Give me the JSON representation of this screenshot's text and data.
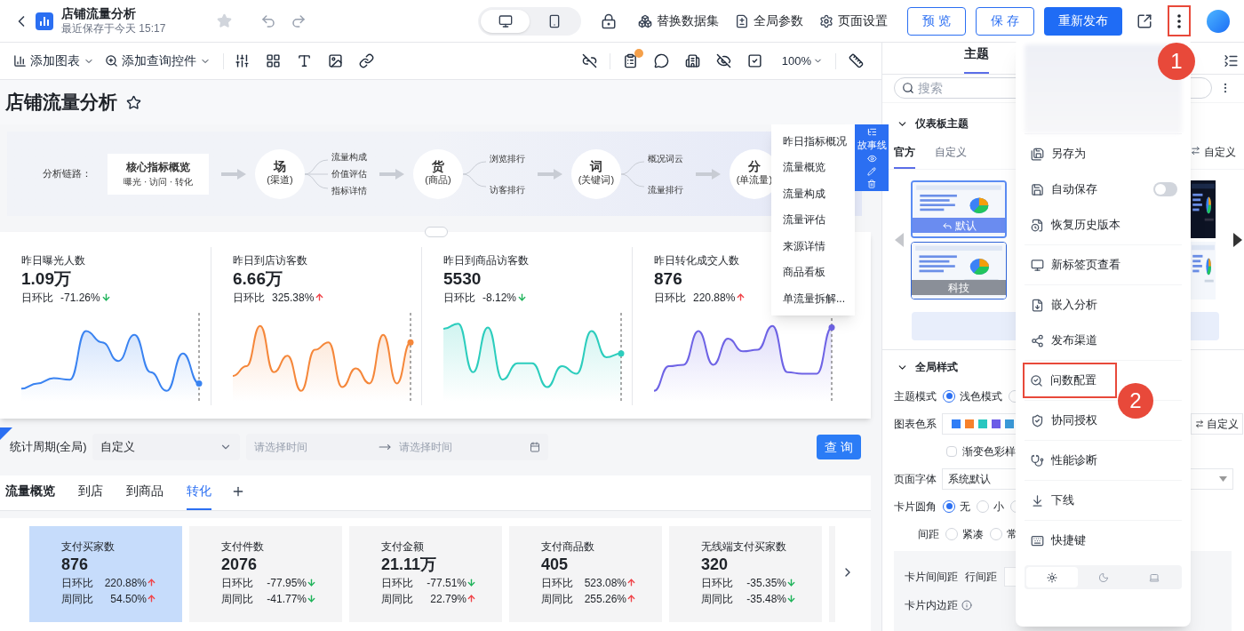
{
  "header": {
    "title": "店铺流量分析",
    "saved_text": "最近保存于今天 15:17",
    "starred": false,
    "device_modes": [
      {
        "kind": "desktop",
        "selected": true
      },
      {
        "kind": "mobile",
        "selected": false
      }
    ],
    "actions": [
      {
        "kind": "dataset",
        "label": "替换数据集"
      },
      {
        "kind": "params",
        "label": "全局参数"
      },
      {
        "kind": "settings",
        "label": "页面设置"
      }
    ],
    "buttons": [
      {
        "kind": "outline",
        "label": "预 览"
      },
      {
        "kind": "outline",
        "label": "保 存"
      },
      {
        "kind": "primary",
        "label": "重新发布"
      }
    ]
  },
  "toolbar": {
    "add_menus": [
      "添加图表",
      "添加查询控件"
    ],
    "zoom": "100%",
    "notes_alert": true
  },
  "page": {
    "title": "店铺流量分析",
    "starred": false
  },
  "chain": {
    "label": "分析链路：",
    "core": {
      "title": "核心指标概览",
      "subtitle": "曝光 · 访问 · 转化"
    },
    "nodes": [
      {
        "char": "场",
        "sub": "(渠道)",
        "branches": [
          "流量构成",
          "价值评估",
          "指标详情"
        ]
      },
      {
        "char": "货",
        "sub": "(商品)",
        "branches": [
          "浏览排行",
          "访客排行"
        ]
      },
      {
        "char": "词",
        "sub": "(关键词)",
        "branches": [
          "概况词云",
          "流量排行"
        ]
      },
      {
        "char": "分",
        "sub": "(单流量)"
      }
    ]
  },
  "story_nav": {
    "side_label": "故事线",
    "items": [
      "昨日指标概况",
      "流量概览",
      "流量构成",
      "流量评估",
      "来源详情",
      "商品看板",
      "单流量拆解..."
    ]
  },
  "kpis": [
    {
      "title": "昨日曝光人数",
      "value": "1.09万",
      "compare_label": "日环比",
      "change": "-71.26%",
      "rising": false,
      "color": "#3a83f1"
    },
    {
      "title": "昨日到店访客数",
      "value": "6.66万",
      "compare_label": "日环比",
      "change": "325.38%",
      "rising": true,
      "color": "#f5873a"
    },
    {
      "title": "昨日到商品访客数",
      "value": "5530",
      "compare_label": "日环比",
      "change": "-8.12%",
      "rising": false,
      "color": "#2ccdbd"
    },
    {
      "title": "昨日转化成交人数",
      "value": "876",
      "compare_label": "日环比",
      "change": "220.88%",
      "rising": true,
      "color": "#6e63e5"
    }
  ],
  "filter": {
    "label": "统计周期(全局)",
    "select_value": "自定义",
    "start_placeholder": "请选择时间",
    "end_placeholder": "请选择时间",
    "button": "查 询"
  },
  "tabs": {
    "title": "流量概览",
    "items": [
      {
        "label": "到店",
        "selected": false
      },
      {
        "label": "到商品",
        "selected": false
      },
      {
        "label": "转化",
        "selected": true
      }
    ]
  },
  "metrics": [
    {
      "title": "支付买家数",
      "value": "876",
      "selected": true,
      "rows": [
        {
          "label": "日环比",
          "value": "220.88%",
          "rising": true
        },
        {
          "label": "周同比",
          "value": "54.50%",
          "rising": true
        }
      ]
    },
    {
      "title": "支付件数",
      "value": "2076",
      "selected": false,
      "rows": [
        {
          "label": "日环比",
          "value": "-77.95%",
          "rising": false
        },
        {
          "label": "周同比",
          "value": "-41.77%",
          "rising": false
        }
      ]
    },
    {
      "title": "支付金额",
      "value": "21.11万",
      "selected": false,
      "rows": [
        {
          "label": "日环比",
          "value": "-77.51%",
          "rising": false
        },
        {
          "label": "周同比",
          "value": "22.79%",
          "rising": true
        }
      ]
    },
    {
      "title": "支付商品数",
      "value": "405",
      "selected": false,
      "rows": [
        {
          "label": "日环比",
          "value": "523.08%",
          "rising": true
        },
        {
          "label": "周同比",
          "value": "255.26%",
          "rising": true
        }
      ]
    },
    {
      "title": "无线端支付买家数",
      "value": "320",
      "selected": false,
      "rows": [
        {
          "label": "日环比",
          "value": "-35.35%",
          "rising": false
        },
        {
          "label": "周同比",
          "value": "-35.48%",
          "rising": false
        }
      ]
    }
  ],
  "theme_panel": {
    "tab": "主题",
    "search_placeholder": "搜索",
    "section_title": "仪表板主题",
    "theme_tabs": [
      {
        "label": "官方",
        "selected": true
      },
      {
        "label": "自定义",
        "selected": false
      }
    ],
    "custom_link": "自定义",
    "thumbnails": [
      {
        "label": "默认",
        "selected": true
      },
      {
        "label": "科技",
        "selected": false
      }
    ],
    "style_title": "全局样式",
    "rows": [
      {
        "kind": "radio",
        "label": "主题模式",
        "options": [
          {
            "label": "浅色模式",
            "selected": true
          },
          {
            "selected": false
          }
        ]
      },
      {
        "kind": "colors",
        "label": "图表色系",
        "colors": [
          {
            "color": "#2f7df6"
          },
          {
            "color": "#f7812c"
          },
          {
            "color": "#28c7c0"
          },
          {
            "color": "#6c5ce7"
          },
          {
            "color": "#3b9ad9"
          }
        ],
        "button": "自定义"
      },
      {
        "kind": "checkbox",
        "label": "渐变色彩样",
        "checked": false
      },
      {
        "kind": "select",
        "label": "页面字体",
        "value": "系统默认"
      },
      {
        "kind": "radio",
        "label": "卡片圆角",
        "options": [
          {
            "label": "无",
            "selected": true
          },
          {
            "label": "小",
            "selected": false
          },
          {
            "selected": false
          }
        ]
      },
      {
        "kind": "radio",
        "label": "间距",
        "options": [
          {
            "label": "紧凑",
            "selected": false
          },
          {
            "label": "常",
            "selected": false
          }
        ]
      }
    ],
    "spacing_labels": [
      "卡片间间距",
      "行间距"
    ],
    "padding_label": "卡片内边距"
  },
  "more_menu": {
    "groups": [
      [
        {
          "kind": "save_as",
          "label": "另存为",
          "highlighted": false
        },
        {
          "kind": "autosave",
          "label": "自动保存",
          "on": false,
          "highlighted": false
        },
        {
          "kind": "history",
          "label": "恢复历史版本",
          "highlighted": false
        }
      ],
      [
        {
          "kind": "new_tab",
          "label": "新标签页查看",
          "highlighted": false
        }
      ],
      [
        {
          "kind": "embed",
          "label": "嵌入分析",
          "highlighted": false
        },
        {
          "kind": "publish",
          "label": "发布渠道",
          "highlighted": false
        }
      ],
      [
        {
          "kind": "ask",
          "label": "问数配置",
          "highlighted": true
        }
      ],
      [
        {
          "kind": "auth",
          "label": "协同授权",
          "highlighted": false
        }
      ],
      [
        {
          "kind": "diagnose",
          "label": "性能诊断",
          "highlighted": false
        }
      ],
      [
        {
          "kind": "offline",
          "label": "下线",
          "highlighted": false
        }
      ],
      [
        {
          "kind": "shortcut",
          "label": "快捷键",
          "highlighted": false
        }
      ]
    ],
    "appearance": [
      {
        "kind": "light",
        "selected": true
      },
      {
        "kind": "dark",
        "selected": false
      },
      {
        "kind": "system",
        "selected": false
      }
    ]
  },
  "annotations": [
    "1",
    "2"
  ]
}
